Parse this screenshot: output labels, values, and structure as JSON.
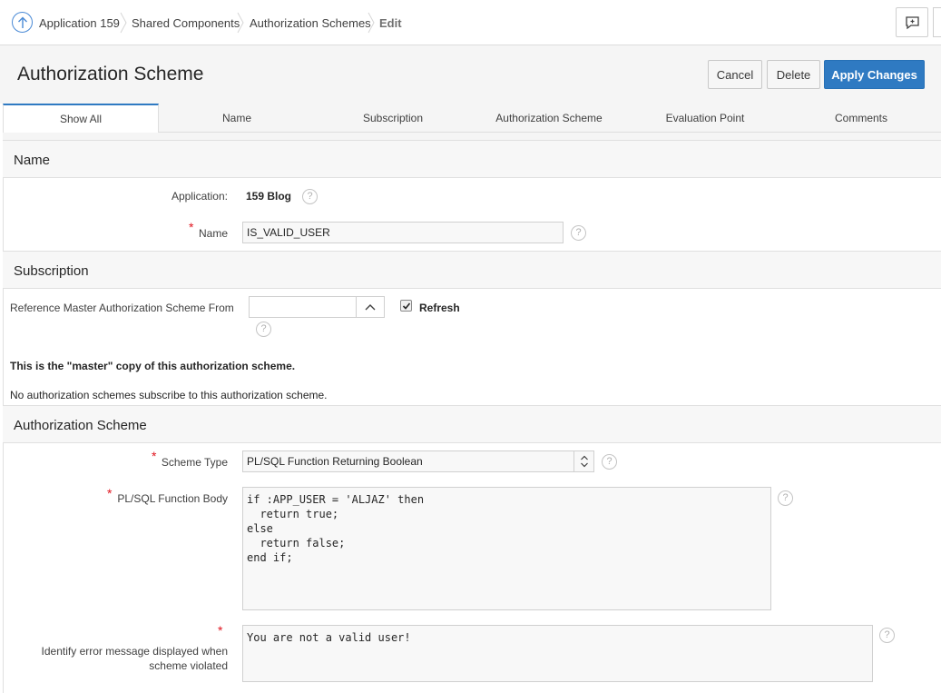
{
  "breadcrumb": {
    "items": [
      "Application 159",
      "Shared Components",
      "Authorization Schemes",
      "Edit"
    ]
  },
  "header": {
    "title": "Authorization Scheme",
    "cancel_label": "Cancel",
    "delete_label": "Delete",
    "apply_label": "Apply Changes"
  },
  "tabs": [
    "Show All",
    "Name",
    "Subscription",
    "Authorization Scheme",
    "Evaluation Point",
    "Comments"
  ],
  "name_region": {
    "title": "Name",
    "application_label": "Application:",
    "application_value": "159 Blog",
    "name_label": "Name",
    "name_value": "IS_VALID_USER"
  },
  "subscription_region": {
    "title": "Subscription",
    "reference_label": "Reference Master Authorization Scheme From",
    "reference_value": "",
    "refresh_label": "Refresh",
    "refresh_checked": true,
    "master_note": "This is the \"master\" copy of this authorization scheme.",
    "subscribers_note": "No authorization schemes subscribe to this authorization scheme."
  },
  "auth_region": {
    "title": "Authorization Scheme",
    "scheme_type_label": "Scheme Type",
    "scheme_type_value": "PL/SQL Function Returning Boolean",
    "function_body_label": "PL/SQL Function Body",
    "function_body_value": "if :APP_USER = 'ALJAZ' then\n  return true;\nelse\n  return false;\nend if;",
    "error_label_line1": "Identify error message displayed when",
    "error_label_line2": "scheme violated",
    "error_value": "You are not a valid user!"
  },
  "icons": {
    "up": "arrow-up-icon",
    "feedback": "feedback-icon",
    "help": "help-icon",
    "chevron_up": "chevron-up-icon",
    "select_arrows": "select-arrows-icon"
  },
  "colors": {
    "accent": "#2f7ac2",
    "required": "#e0141e",
    "region_bg": "#f7f7f7"
  },
  "help_glyph": "?",
  "required_glyph": "*"
}
